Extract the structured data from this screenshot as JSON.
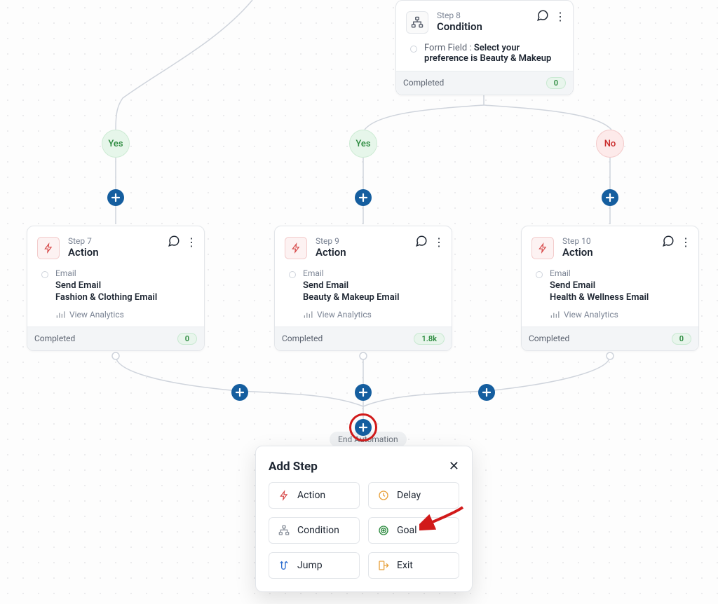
{
  "yes_label": "Yes",
  "no_label": "No",
  "end_label": "End Automation",
  "analytics_label": "View Analytics",
  "completed_label": "Completed",
  "condition_card": {
    "step": "Step 8",
    "title": "Condition",
    "body_prefix": "Form Field : ",
    "body_bold": "Select your preference is Beauty & Makeup",
    "count": "0"
  },
  "action_left": {
    "step": "Step 7",
    "title": "Action",
    "type_label": "Email",
    "line1": "Send Email",
    "line2": "Fashion & Clothing Email",
    "count": "0"
  },
  "action_mid": {
    "step": "Step 9",
    "title": "Action",
    "type_label": "Email",
    "line1": "Send Email",
    "line2": "Beauty & Makeup Email",
    "count": "1.8k"
  },
  "action_right": {
    "step": "Step 10",
    "title": "Action",
    "type_label": "Email",
    "line1": "Send Email",
    "line2": "Health & Wellness Email",
    "count": "0"
  },
  "popover": {
    "title": "Add Step",
    "options": {
      "action": "Action",
      "delay": "Delay",
      "condition": "Condition",
      "goal": "Goal",
      "jump": "Jump",
      "exit": "Exit"
    }
  }
}
